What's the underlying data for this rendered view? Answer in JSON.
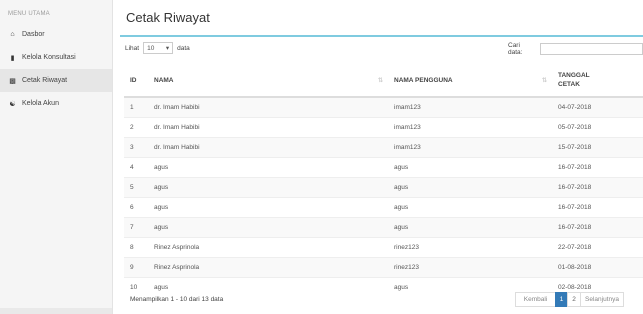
{
  "sidebar": {
    "header": "MENU UTAMA",
    "items": [
      {
        "label": "Dasbor",
        "icon": "home-icon"
      },
      {
        "label": "Kelola Konsultasi",
        "icon": "book-icon"
      },
      {
        "label": "Cetak Riwayat",
        "icon": "print-icon"
      },
      {
        "label": "Kelola Akun",
        "icon": "users-icon"
      }
    ]
  },
  "page": {
    "title": "Cetak Riwayat"
  },
  "controls": {
    "show_label": "Lihat",
    "show_value": "10",
    "show_suffix": "data",
    "search_label": "Cari data:",
    "search_value": ""
  },
  "table": {
    "headers": {
      "id": "ID",
      "nama": "NAMA",
      "pengguna": "NAMA PENGGUNA",
      "tanggal": "TANGGAL\nCETAK"
    },
    "rows": [
      {
        "id": "1",
        "nama": "dr. Imam Habibi",
        "pengguna": "imam123",
        "tanggal": "04-07-2018"
      },
      {
        "id": "2",
        "nama": "dr. Imam Habibi",
        "pengguna": "imam123",
        "tanggal": "05-07-2018"
      },
      {
        "id": "3",
        "nama": "dr. Imam Habibi",
        "pengguna": "imam123",
        "tanggal": "15-07-2018"
      },
      {
        "id": "4",
        "nama": "agus",
        "pengguna": "agus",
        "tanggal": "16-07-2018"
      },
      {
        "id": "5",
        "nama": "agus",
        "pengguna": "agus",
        "tanggal": "16-07-2018"
      },
      {
        "id": "6",
        "nama": "agus",
        "pengguna": "agus",
        "tanggal": "16-07-2018"
      },
      {
        "id": "7",
        "nama": "agus",
        "pengguna": "agus",
        "tanggal": "16-07-2018"
      },
      {
        "id": "8",
        "nama": "Rinez Asprinola",
        "pengguna": "rinez123",
        "tanggal": "22-07-2018"
      },
      {
        "id": "9",
        "nama": "Rinez Asprinola",
        "pengguna": "rinez123",
        "tanggal": "01-08-2018"
      },
      {
        "id": "10",
        "nama": "agus",
        "pengguna": "agus",
        "tanggal": "02-08-2018"
      }
    ]
  },
  "footer": {
    "info": "Menampilkan 1 - 10 dari 13 data",
    "prev": "Kembali",
    "pages": [
      "1",
      "2"
    ],
    "next": "Selanjutnya"
  },
  "colors": {
    "accent": "#7fcbe0",
    "active_page": "#337ab7"
  }
}
